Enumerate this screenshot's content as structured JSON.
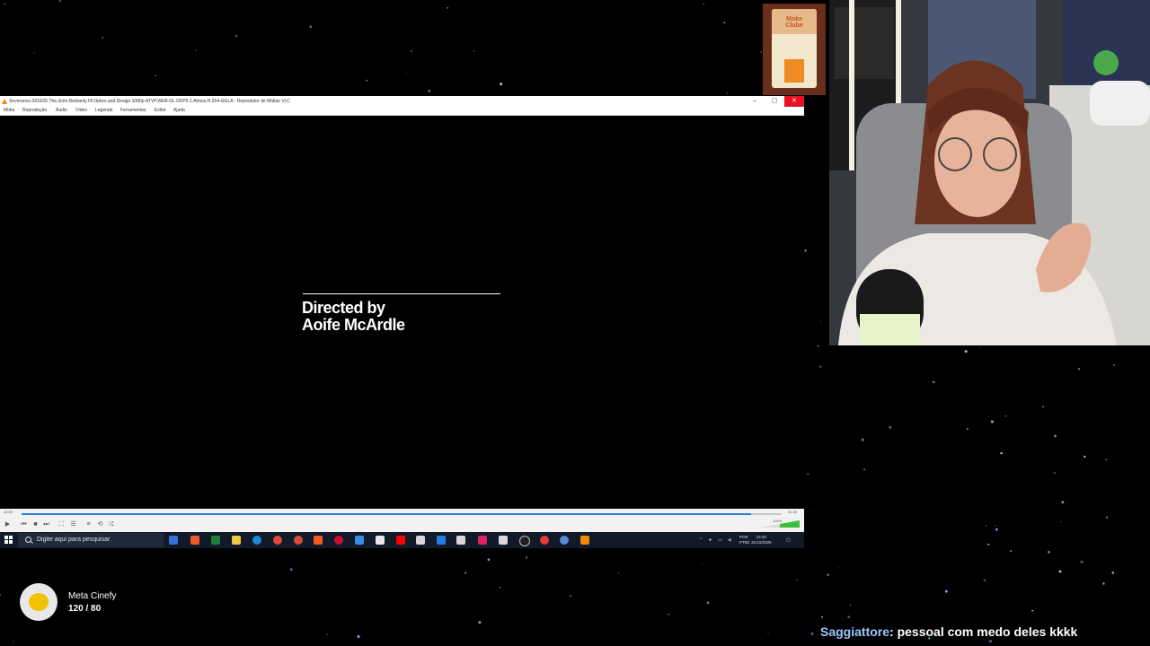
{
  "vlc": {
    "window_title": "Severance.S01E05.The.Grim.Barbarity.Of.Optics.and.Design.1080p.ATVP.WEB-DL.DDP5.1.Atmos.H.264-GGLA - Reprodutor de Mídias VLC",
    "window_buttons": {
      "minimize": "–",
      "maximize": "▢",
      "close": "✕"
    },
    "menu": [
      "Mídia",
      "Reprodução",
      "Áudio",
      "Vídeo",
      "Legenda",
      "Ferramentas",
      "Exibir",
      "Ajuda"
    ],
    "video": {
      "credit_line1": "Directed by",
      "credit_line2": "Aoife McArdle"
    },
    "elapsed_time": "42:59",
    "total_time": "51:30",
    "progress": 0.96,
    "volume_label": "100%",
    "accent": "#2e7fd8"
  },
  "taskbar": {
    "search_placeholder": "Digite aqui para pesquisar",
    "language_line1": "POR",
    "language_line2": "PTB2",
    "time": "23:40",
    "date": "31/10/2025"
  },
  "product": {
    "brand_text": "Moka Clube"
  },
  "meta_widget": {
    "title": "Meta Cinefy",
    "count": "120 / 80"
  },
  "chat": {
    "username": "Saggiattore",
    "message": ": pessoal com medo deles kkkk"
  },
  "colors": {
    "background": "#000000",
    "taskbar": "#121a2a",
    "close": "#e81123",
    "chat_user": "#9bc7ff"
  }
}
